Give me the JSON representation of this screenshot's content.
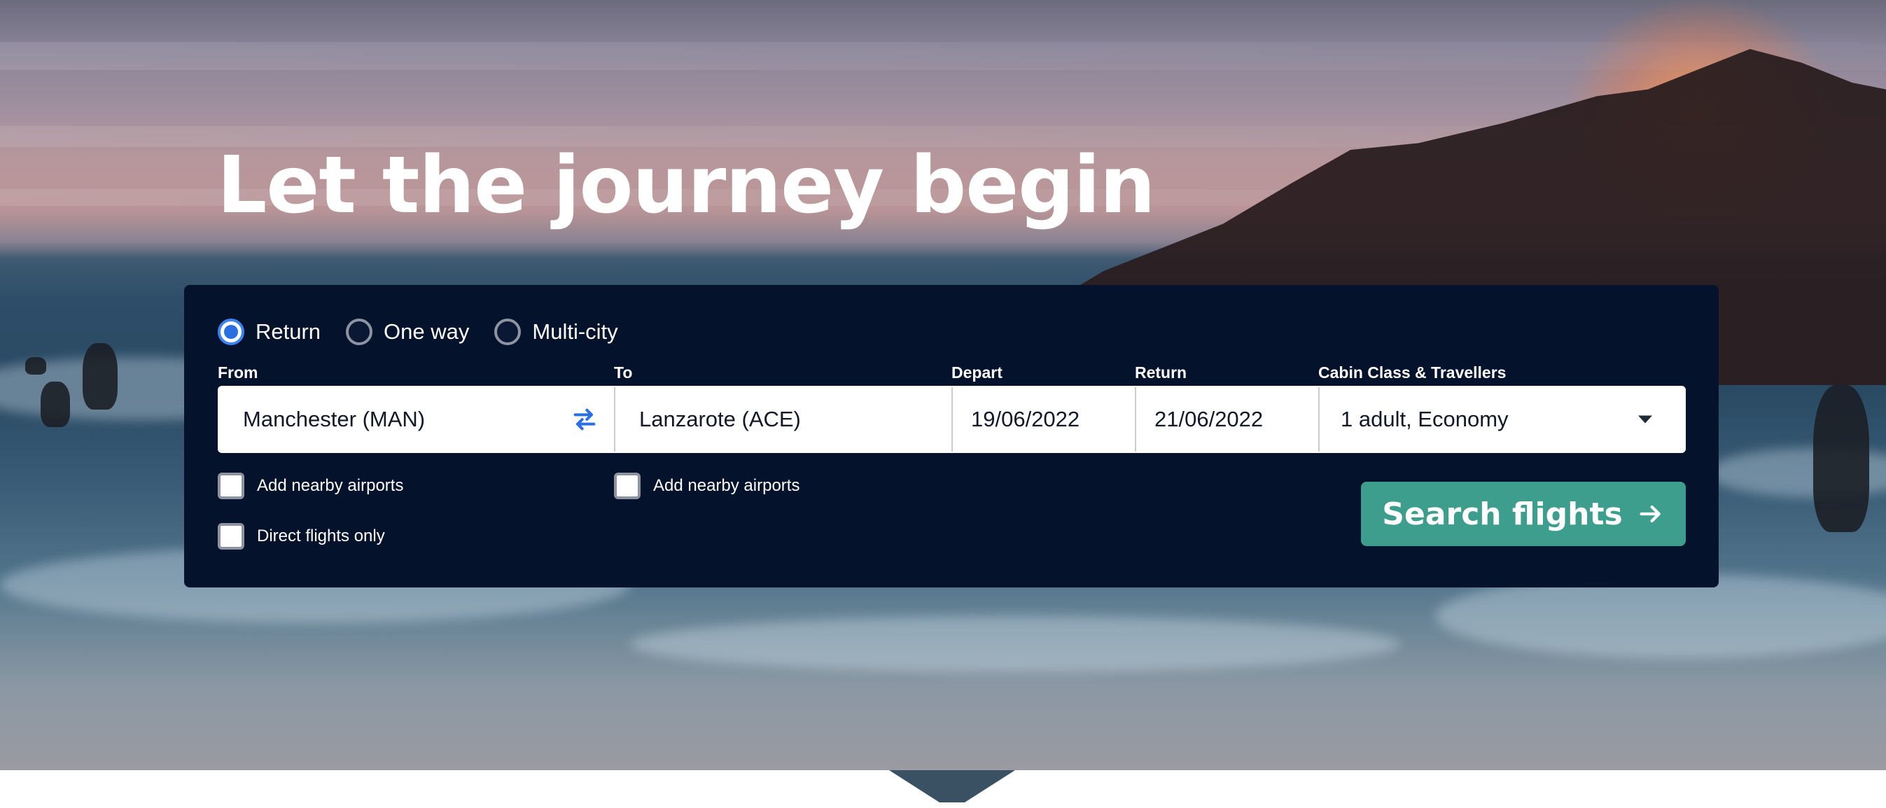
{
  "hero": {
    "title": "Let the journey begin"
  },
  "trip_types": [
    {
      "label": "Return",
      "selected": true
    },
    {
      "label": "One way",
      "selected": false
    },
    {
      "label": "Multi-city",
      "selected": false
    }
  ],
  "fields": {
    "from": {
      "label": "From",
      "value": "Manchester (MAN)"
    },
    "to": {
      "label": "To",
      "value": "Lanzarote (ACE)"
    },
    "depart": {
      "label": "Depart",
      "value": "19/06/2022"
    },
    "return": {
      "label": "Return",
      "value": "21/06/2022"
    },
    "cabin": {
      "label": "Cabin Class & Travellers",
      "value": "1 adult, Economy"
    }
  },
  "options": {
    "from_nearby": {
      "label": "Add nearby airports",
      "checked": false
    },
    "to_nearby": {
      "label": "Add nearby airports",
      "checked": false
    },
    "direct_only": {
      "label": "Direct flights only",
      "checked": false
    }
  },
  "search_button": {
    "label": "Search flights"
  },
  "colors": {
    "panel_bg": "#05122b",
    "accent_blue": "#2a6fe0",
    "button_green": "#3e9e8e",
    "text_white": "#ffffff"
  },
  "icons": {
    "swap": "swap-arrows-icon",
    "caret": "caret-down-icon",
    "arrow": "arrow-right-icon"
  }
}
